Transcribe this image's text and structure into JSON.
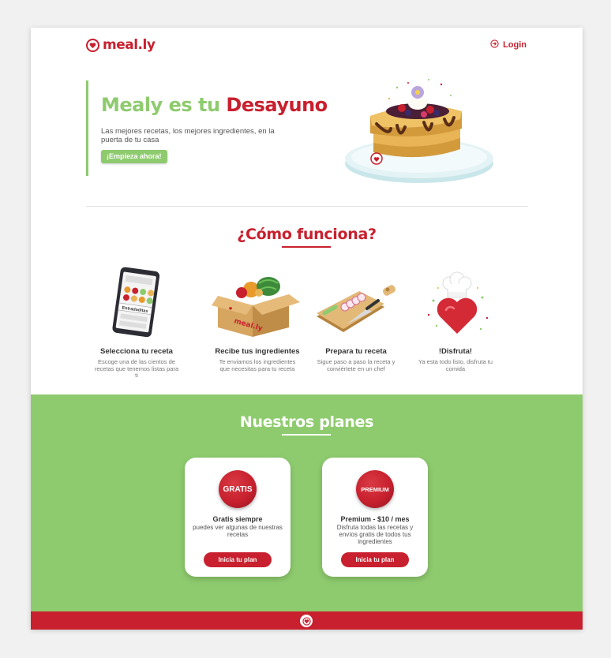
{
  "brand": {
    "name": "meal.ly",
    "color_primary": "#c8202e",
    "color_secondary": "#8ecb6e"
  },
  "header": {
    "login_label": "Login",
    "login_icon": "login-arrow-icon"
  },
  "hero": {
    "title_part1": "Mealy es tu",
    "title_part2": "Desayuno",
    "subtitle": "Las mejores recetas, los mejores ingredientes, en la puerta de tu casa",
    "cta_label": "¡Empieza ahora!",
    "illustration": "waffle-plate-illustration"
  },
  "how": {
    "title": "¿Cómo funciona?",
    "steps": [
      {
        "title": "Selecciona tu receta",
        "desc": "Escoge una de las cientos de recetas que tenemos listas para ti",
        "icon": "phone-recipes-icon",
        "phone_label": "Entradaditas"
      },
      {
        "title": "Recibe tus ingredientes",
        "desc": "Te enviamos los ingredientes que necesitas para tu receta",
        "icon": "delivery-box-icon",
        "box_label": "meal.ly"
      },
      {
        "title": "Prepara tu receta",
        "desc": "Sigue paso a paso la receta y conviértete en un chef",
        "icon": "cutting-board-icon"
      },
      {
        "title": "!Disfruta!",
        "desc": "Ya esta todo listo, disfruta tu comida",
        "icon": "chef-heart-icon"
      }
    ]
  },
  "plans": {
    "title": "Nuestros planes",
    "items": [
      {
        "badge": "GRATIS",
        "name": "Gratis siempre",
        "desc": "puedes ver algunas de nuestras recetas",
        "button": "Inicia tu plan"
      },
      {
        "badge": "PREMIUM",
        "name": "Premium - $10 / mes",
        "desc": "Disfruta todas las recetas y envíos gratis de todos tus ingredientes",
        "button": "Inicia tu plan"
      }
    ]
  },
  "footer": {
    "icon": "heart-logo-icon"
  }
}
